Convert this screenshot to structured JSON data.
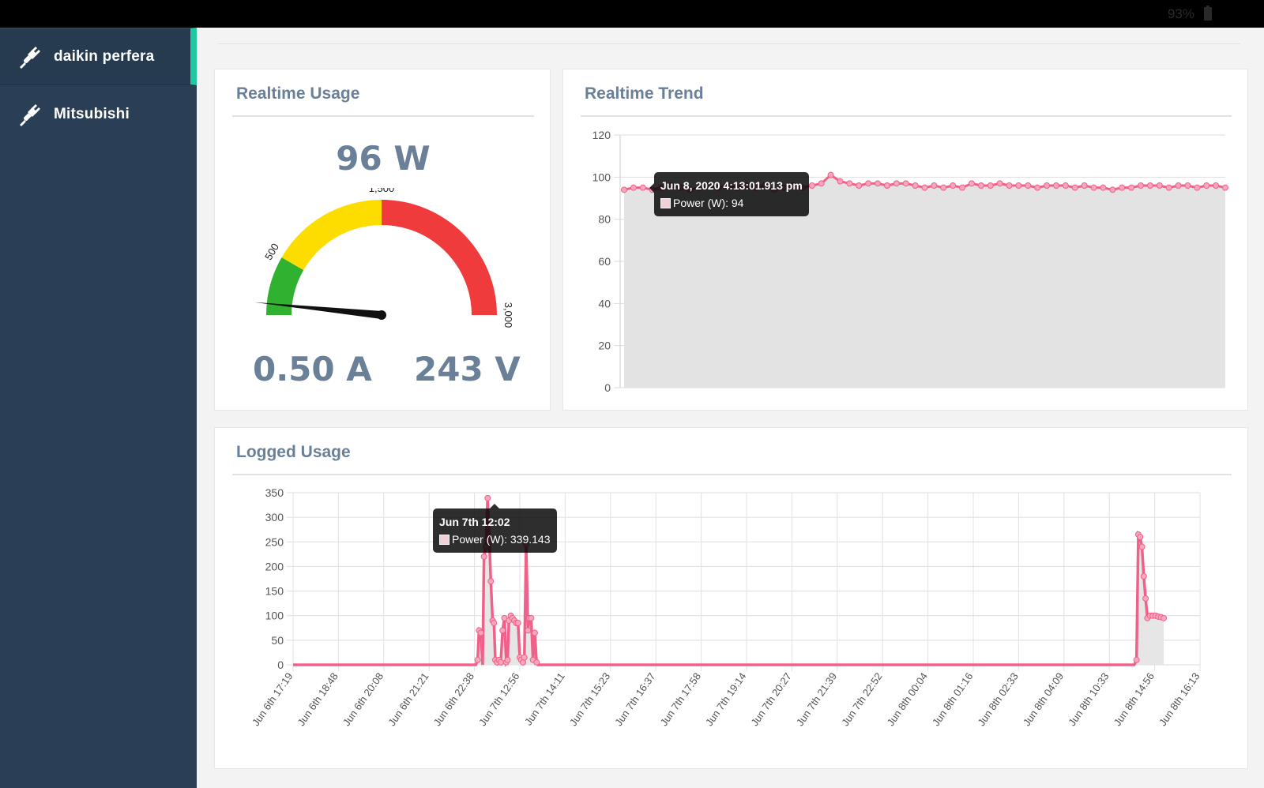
{
  "status_bar": {
    "battery": "93%"
  },
  "sidebar": {
    "items": [
      {
        "label": "daikin perfera",
        "icon": "plug-icon",
        "active": true
      },
      {
        "label": "Mitsubishi",
        "icon": "plug-icon",
        "active": false
      }
    ],
    "accent": "#1fc8a0"
  },
  "realtime_usage": {
    "title": "Realtime Usage",
    "power": "96 W",
    "current": "0.50 A",
    "voltage": "243 V",
    "gauge": {
      "min": 0,
      "max": 3000,
      "value": 96,
      "ticks": [
        "500",
        "1,500",
        "3,000"
      ],
      "bands": [
        {
          "from": 0,
          "to": 500,
          "color": "#30b12f"
        },
        {
          "from": 500,
          "to": 1500,
          "color": "#fddd00"
        },
        {
          "from": 1500,
          "to": 3000,
          "color": "#ef3b3b"
        }
      ]
    }
  },
  "realtime_trend": {
    "title": "Realtime Trend",
    "tooltip": {
      "title": "Jun 8, 2020 4:13:01.913 pm",
      "body": "Power (W): 94"
    },
    "chart_data": {
      "type": "area",
      "ylim": [
        0,
        120
      ],
      "yticks": [
        "0",
        "20",
        "40",
        "60",
        "80",
        "100",
        "120"
      ],
      "series": [
        {
          "values": [
            94,
            95,
            95,
            94,
            95,
            96,
            95,
            94,
            95,
            96,
            95,
            96,
            95,
            96,
            95,
            96,
            94,
            95,
            96,
            95,
            96,
            97,
            101,
            98,
            97,
            96,
            97,
            97,
            96,
            97,
            97,
            96,
            95,
            96,
            95,
            96,
            95,
            97,
            96,
            96,
            97,
            96,
            96,
            96,
            95,
            96,
            96,
            96,
            95,
            96,
            95,
            95,
            94,
            95,
            95,
            96,
            96,
            96,
            95,
            96,
            96,
            95,
            96,
            96,
            95
          ]
        }
      ],
      "color": "#f06189"
    }
  },
  "logged_usage": {
    "title": "Logged Usage",
    "tooltip": {
      "title": "Jun 7th 12:02",
      "body": "Power (W): 339.143"
    },
    "chart_data": {
      "type": "line",
      "ylim": [
        0,
        350
      ],
      "yticks": [
        "0",
        "50",
        "100",
        "150",
        "200",
        "250",
        "300",
        "350"
      ],
      "categories": [
        "Jun 6th 17:19",
        "Jun 6th 18:48",
        "Jun 6th 20:08",
        "Jun 6th 21:21",
        "Jun 6th 22:38",
        "Jun 7th 12:56",
        "Jun 7th 14:11",
        "Jun 7th 15:23",
        "Jun 7th 16:37",
        "Jun 7th 17:58",
        "Jun 7th 19:14",
        "Jun 7th 20:27",
        "Jun 7th 21:39",
        "Jun 7th 22:52",
        "Jun 8th 00:04",
        "Jun 8th 01:16",
        "Jun 8th 02:33",
        "Jun 8th 04:09",
        "Jun 8th 10:33",
        "Jun 8th 14:56",
        "Jun 8th 16:13"
      ],
      "series": [
        {
          "name": "Power (W)",
          "points": [
            [
              0,
              0
            ],
            [
              4.03,
              0
            ],
            [
              4.07,
              10
            ],
            [
              4.1,
              70
            ],
            [
              4.14,
              65
            ],
            [
              4.18,
              0
            ],
            [
              4.21,
              220
            ],
            [
              4.25,
              240
            ],
            [
              4.29,
              339
            ],
            [
              4.33,
              250
            ],
            [
              4.36,
              170
            ],
            [
              4.4,
              90
            ],
            [
              4.43,
              85
            ],
            [
              4.46,
              10
            ],
            [
              4.5,
              5
            ],
            [
              4.54,
              10
            ],
            [
              4.58,
              5
            ],
            [
              4.62,
              70
            ],
            [
              4.66,
              95
            ],
            [
              4.7,
              5
            ],
            [
              4.73,
              10
            ],
            [
              4.76,
              90
            ],
            [
              4.8,
              100
            ],
            [
              4.84,
              95
            ],
            [
              4.88,
              90
            ],
            [
              4.92,
              85
            ],
            [
              4.96,
              85
            ],
            [
              5.0,
              15
            ],
            [
              5.03,
              10
            ],
            [
              5.07,
              5
            ],
            [
              5.1,
              15
            ],
            [
              5.14,
              245
            ],
            [
              5.18,
              70
            ],
            [
              5.21,
              95
            ],
            [
              5.25,
              95
            ],
            [
              5.29,
              10
            ],
            [
              5.33,
              65
            ],
            [
              5.37,
              5
            ],
            [
              5.4,
              0
            ],
            [
              18.55,
              0
            ],
            [
              18.6,
              10
            ],
            [
              18.64,
              265
            ],
            [
              18.68,
              260
            ],
            [
              18.72,
              240
            ],
            [
              18.76,
              180
            ],
            [
              18.8,
              135
            ],
            [
              18.84,
              95
            ],
            [
              18.9,
              100
            ],
            [
              18.96,
              100
            ],
            [
              19.02,
              100
            ],
            [
              19.08,
              98
            ],
            [
              19.14,
              97
            ],
            [
              19.2,
              95
            ]
          ]
        }
      ],
      "color": "#f06189"
    }
  }
}
